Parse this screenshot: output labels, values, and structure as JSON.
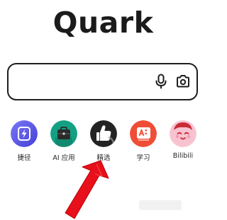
{
  "app": {
    "logo_text": "Quark"
  },
  "search": {
    "value": "",
    "placeholder": "",
    "icons": [
      "microphone-icon",
      "camera-icon"
    ]
  },
  "shortcuts": [
    {
      "label": "捷径",
      "icon": "lightning-icon",
      "color": "#5b57e8"
    },
    {
      "label": "AI 应用",
      "icon": "briefcase-icon",
      "color": "#14a082"
    },
    {
      "label": "精选",
      "icon": "thumbs-up-icon",
      "color": "#232323"
    },
    {
      "label": "学习",
      "icon": "study-icon",
      "color": "#f04d36"
    },
    {
      "label": "Bilibili",
      "icon": "bilibili-face-icon",
      "color": "#f8c3d0"
    }
  ],
  "annotation": {
    "icon": "red-arrow-icon",
    "color": "#e8101a"
  }
}
